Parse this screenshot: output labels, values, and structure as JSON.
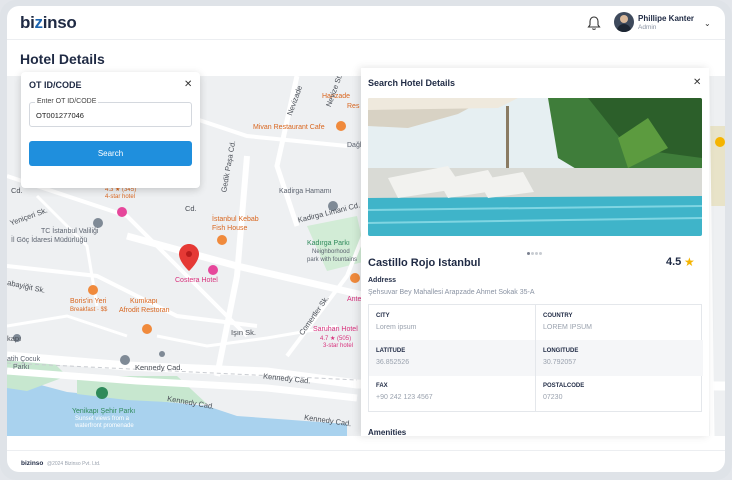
{
  "brand": {
    "name_pre": "bi",
    "name_i": "z",
    "name_post": "inso"
  },
  "header": {
    "user_name": "Phillipe Kanter",
    "user_role": "Admin"
  },
  "page": {
    "title": "Hotel Details"
  },
  "ot_panel": {
    "title": "OT ID/CODE",
    "field_label": "Enter OT ID/CODE",
    "field_value": "OT001277046",
    "search_label": "Search"
  },
  "map": {
    "labels": [
      "Hanzade",
      "Res",
      "Mivan Restaurant Cafe",
      "Dağh",
      "Kadirga Hamamı",
      "İstanbul Kebab",
      "Fish House",
      "Kadirga Limani Cd.",
      "Kadırga Parkı",
      "Neighborhood",
      "park with fountains",
      "TC İstanbul Valiliği",
      "İl Göç İdaresi Müdürlüğü",
      "Costera Hotel",
      "Boris'in Yeri",
      "Breakfast · $$",
      "Kumkapı",
      "Afrodit Restoran",
      "Işın Sk.",
      "Saruhan Hotel",
      "4.7 ★ (505)",
      "3-star hotel",
      "Kennedy Cad.",
      "Kennedy Cad.",
      "Kennedy Cad.",
      "Kennedy Cad.",
      "Yenikapı Şehir Parkı",
      "Sunset views from a",
      "waterfront promenade",
      "Antea",
      "atih Çocuk",
      "Parkı",
      "kapı",
      "abayiğit Sk.",
      "Cd.",
      "Yeniçeri Sk.",
      "Cd.",
      "Comertler Sk.",
      "Nevizade",
      "Nevize St.",
      "Gedik Paşa Cd.",
      "4-star hotel",
      "4.3 ★ (345)"
    ]
  },
  "drawer": {
    "title": "Search Hotel Details",
    "hotel_name": "Castillo Rojo Istanbul",
    "rating": "4.5",
    "address_label": "Address",
    "address_value": "Şehsuvar Bey Mahallesi Arapzade Ahmet Sokak 35-A",
    "fields": [
      {
        "key": "CITY",
        "value": "Lorem ipsum"
      },
      {
        "key": "COUNTRY",
        "value": "LOREM IPSUM"
      },
      {
        "key": "LATITUDE",
        "value": "36.852526"
      },
      {
        "key": "LONGITUDE",
        "value": "30.792057"
      },
      {
        "key": "FAX",
        "value": "+90 242 123 4567"
      },
      {
        "key": "POSTALCODE",
        "value": "07230"
      }
    ],
    "amenities_label": "Amenities"
  },
  "footer": {
    "logo": "bizinso",
    "copyright": "@2024 Bizinso Pvt. Ltd."
  },
  "colors": {
    "primary": "#1f8fdd",
    "brand_accent": "#1c64b0",
    "star": "#f5b400",
    "map_pin": "#e53935"
  },
  "icons": [
    "bell-icon",
    "chevron-down-icon",
    "close-icon",
    "star-icon",
    "map-pin-icon"
  ]
}
